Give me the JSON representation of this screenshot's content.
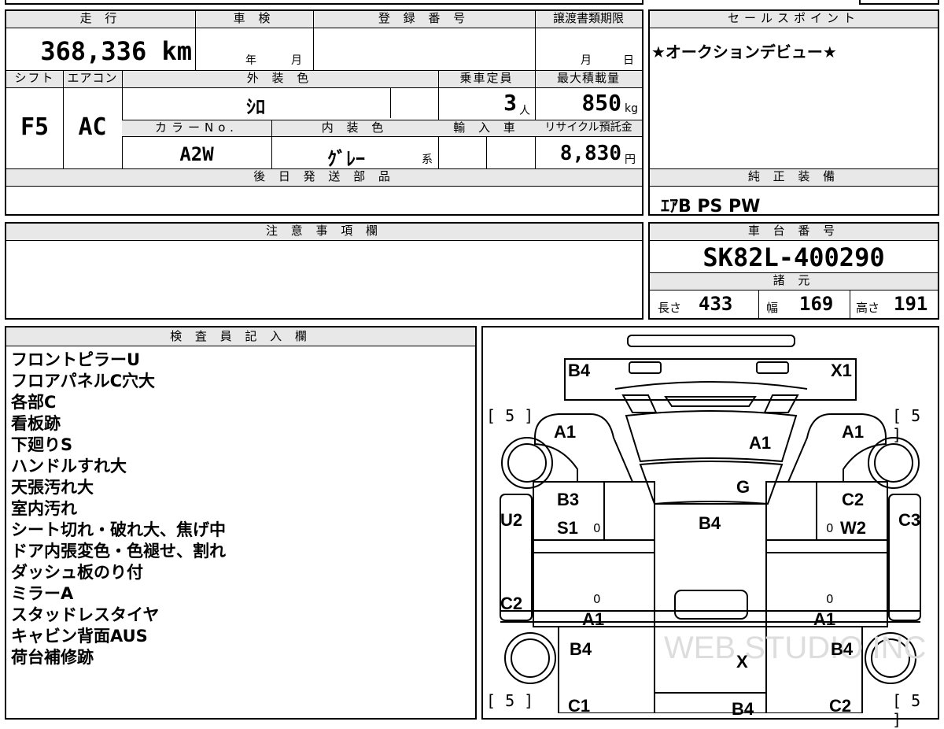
{
  "mileage": {
    "label": "走 行",
    "value": "368,336",
    "unit": "km"
  },
  "shaken": {
    "label": "車 検",
    "year_unit": "年",
    "month_unit": "月"
  },
  "registration": {
    "label": "登 録 番 号",
    "value": ""
  },
  "transfer": {
    "label": "譲渡書類期限",
    "month_unit": "月",
    "day_unit": "日"
  },
  "sales_point": {
    "label": "セールスポイント",
    "text": "★オークションデビュー★"
  },
  "shift": {
    "label": "シフト",
    "value": "F5"
  },
  "aircon": {
    "label": "エアコン",
    "value": "AC"
  },
  "exterior_color": {
    "label": "外 装 色",
    "value": "ｼﾛ"
  },
  "capacity": {
    "label": "乗車定員",
    "value": "3",
    "unit": "人"
  },
  "max_load": {
    "label": "最大積載量",
    "value": "850",
    "unit": "kg"
  },
  "color_no": {
    "label": "カラーNo.",
    "value": "A2W"
  },
  "interior_color": {
    "label": "内 装 色",
    "value": "ｸﾞﾚｰ",
    "suffix": "系"
  },
  "import": {
    "label": "輸 入 車",
    "value": ""
  },
  "recycle": {
    "label": "リサイクル預託金",
    "value": "8,830",
    "unit": "円"
  },
  "later_parts": {
    "label": "後 日 発 送 部 品",
    "value": ""
  },
  "equipment": {
    "label": "純 正 装 備",
    "value": "ｴｱB PS PW"
  },
  "notes": {
    "label": "注 意 事 項 欄",
    "value": ""
  },
  "chassis": {
    "label": "車 台 番 号",
    "value": "SK82L-400290"
  },
  "specs": {
    "label": "諸 元",
    "length_label": "長さ",
    "length": "433",
    "width_label": "幅",
    "width": "169",
    "height_label": "高さ",
    "height": "191"
  },
  "inspector": {
    "label": "検 査 員 記 入 欄",
    "items": [
      "フロントピラーU",
      "フロアパネルC穴大",
      "各部C",
      "看板跡",
      "下廻りS",
      "ハンドルすれ大",
      "天張汚れ大",
      "室内汚れ",
      "シート切れ・破れ大、焦げ中",
      "ドア内張変色・色褪せ、割れ",
      "ダッシュ板のり付",
      "ミラーA",
      "スタッドレスタイヤ",
      "キャビン背面AUS",
      "荷台補修跡"
    ]
  },
  "diagram": {
    "labels": {
      "b4_top": "B4",
      "x1": "X1",
      "a1_left": "A1",
      "a1_center": "A1",
      "a1_right": "A1",
      "g": "G",
      "b3": "B3",
      "s1": "S1",
      "c2_right_top": "C2",
      "w2": "W2",
      "b4_center": "B4",
      "u2": "U2",
      "c3": "C3",
      "c2_left": "C2",
      "a1_lower_left": "A1",
      "a1_lower_right": "A1",
      "b4_lower_left": "B4",
      "x_center": "X",
      "b4_lower_right": "B4",
      "c1": "C1",
      "b4_bottom": "B4",
      "c2_bottom_right": "C2"
    },
    "tire_depth": "5",
    "zero": "0",
    "watermark": "WEB STUDIO INC"
  }
}
